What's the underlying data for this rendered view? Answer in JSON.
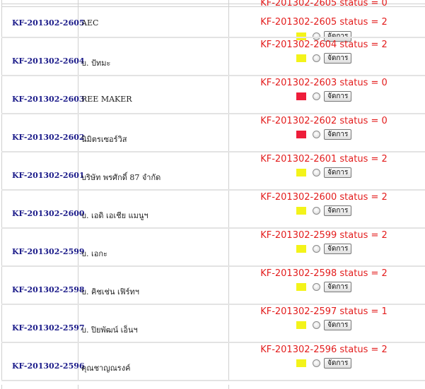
{
  "header_status": "KF-201302-2605 status = 0",
  "manage_label": "จัดการ",
  "colors": {
    "yellow": "#f3f31a",
    "red": "#ee1d3a",
    "status_text": "#e31d1d",
    "code_text": "#1c1c8a"
  },
  "rows": [
    {
      "code": "KF-201302-2605",
      "name": "AEC",
      "status_text": "KF-201302-2605 status = 2",
      "flag": "yellow"
    },
    {
      "code": "KF-201302-2604",
      "name": "บ. ป้ทมะ",
      "status_text": "KF-201302-2604 status = 2",
      "flag": "yellow"
    },
    {
      "code": "KF-201302-2603",
      "name": "REE MAKER",
      "status_text": "KF-201302-2603 status = 0",
      "flag": "red"
    },
    {
      "code": "KF-201302-2602",
      "name": "นิมิตรเซอร์วิส",
      "status_text": "KF-201302-2602 status = 0",
      "flag": "red"
    },
    {
      "code": "KF-201302-2601",
      "name": "บริษัท พรศักดิ์ 87 จำกัด",
      "status_text": "KF-201302-2601 status = 2",
      "flag": "yellow"
    },
    {
      "code": "KF-201302-2600",
      "name": "บ. เอดิ เอเชีย แมนูฯ",
      "status_text": "KF-201302-2600 status = 2",
      "flag": "yellow"
    },
    {
      "code": "KF-201302-2599",
      "name": "บ. เอกะ",
      "status_text": "KF-201302-2599 status = 2",
      "flag": "yellow"
    },
    {
      "code": "KF-201302-2598",
      "name": "บ. คิชเช่น เฟิร์ทฯ",
      "status_text": "KF-201302-2598 status = 2",
      "flag": "yellow"
    },
    {
      "code": "KF-201302-2597",
      "name": "บ. ปิยพัฒน์ เอ็นฯ",
      "status_text": "KF-201302-2597 status = 1",
      "flag": "yellow"
    },
    {
      "code": "KF-201302-2596",
      "name": "คุณชาญณรงค์",
      "status_text": "KF-201302-2596 status = 2",
      "flag": "yellow"
    }
  ]
}
